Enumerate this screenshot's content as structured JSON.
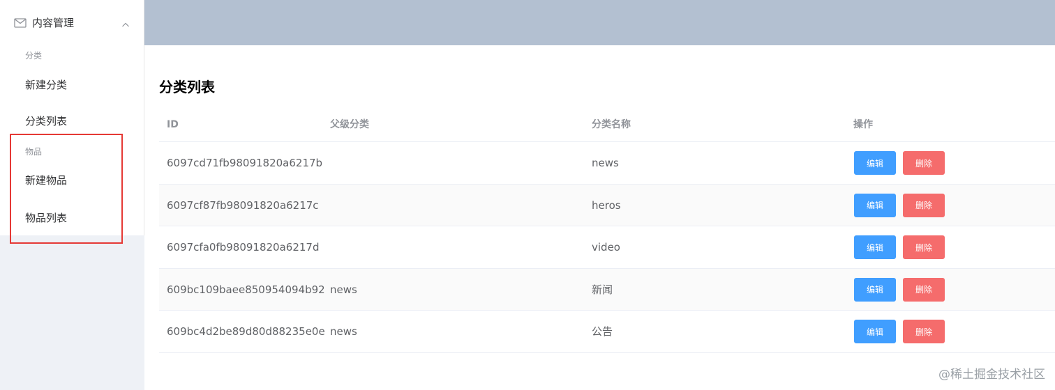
{
  "sidebar": {
    "submenu_title": "内容管理",
    "groups": [
      {
        "title": "分类",
        "items": [
          "新建分类",
          "分类列表"
        ]
      },
      {
        "title": "物品",
        "items": [
          "新建物品",
          "物品列表"
        ]
      }
    ]
  },
  "main": {
    "title": "分类列表",
    "columns": [
      "ID",
      "父级分类",
      "分类名称",
      "操作"
    ],
    "rows": [
      {
        "id": "6097cd71fb98091820a6217b",
        "parent": "",
        "name": "news"
      },
      {
        "id": "6097cf87fb98091820a6217c",
        "parent": "",
        "name": "heros"
      },
      {
        "id": "6097cfa0fb98091820a6217d",
        "parent": "",
        "name": "video"
      },
      {
        "id": "609bc109baee850954094b92",
        "parent": "news",
        "name": "新闻"
      },
      {
        "id": "609bc4d2be89d80d88235e0e",
        "parent": "news",
        "name": "公告"
      }
    ],
    "edit_label": "编辑",
    "delete_label": "删除"
  },
  "watermark": "@稀土掘金技术社区",
  "colors": {
    "header_bg": "#b3c0d1",
    "primary": "#409eff",
    "danger": "#f56c6c",
    "highlight": "#e53935"
  },
  "icons": {
    "submenu_icon": "mail-icon",
    "submenu_toggle": "chevron-up-icon"
  }
}
